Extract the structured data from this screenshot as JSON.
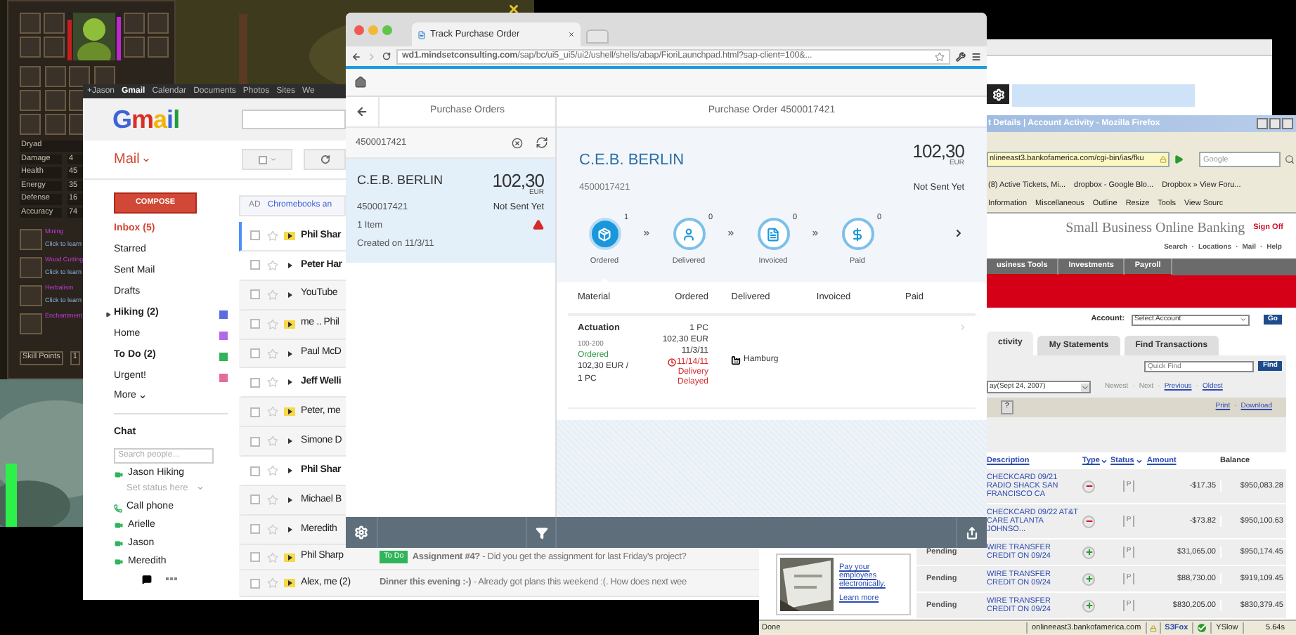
{
  "game": {
    "bars": [
      {
        "level": 0.85,
        "color": "#c81e1e"
      },
      {
        "level": 0.9,
        "color": "#c026d3"
      }
    ],
    "class_name": "Dryad",
    "stats": [
      {
        "label": "Damage",
        "value": "4"
      },
      {
        "label": "Health",
        "value": "45"
      },
      {
        "label": "Energy",
        "value": "35"
      },
      {
        "label": "Defense",
        "value": "16"
      },
      {
        "label": "Accuracy",
        "value": "74"
      }
    ],
    "skills": [
      {
        "name": "Mining",
        "action": "Click to learn"
      },
      {
        "name": "Wood Cutting",
        "action": "Click to learn"
      },
      {
        "name": "Herbalism",
        "action": "Click to learn"
      },
      {
        "name": "Enchantment"
      }
    ],
    "skill_points": {
      "label": "Skill Points",
      "value": "1"
    }
  },
  "gmail": {
    "top_links": [
      {
        "label": "+Jason",
        "selected": false
      },
      {
        "label": "Gmail",
        "selected": true
      },
      {
        "label": "Calendar",
        "selected": false
      },
      {
        "label": "Documents",
        "selected": false
      },
      {
        "label": "Photos",
        "selected": false
      },
      {
        "label": "Sites",
        "selected": false
      },
      {
        "label": "We",
        "selected": false
      }
    ],
    "logo": "Gmail",
    "app_menu": "Mail",
    "compose": "COMPOSE",
    "labels": [
      {
        "name": "Inbox (5)",
        "selected": true,
        "unread": true,
        "collapsible": false
      },
      {
        "name": "Starred",
        "selected": false,
        "unread": false,
        "collapsible": false
      },
      {
        "name": "Sent Mail",
        "selected": false,
        "unread": false,
        "collapsible": false
      },
      {
        "name": "Drafts",
        "selected": false,
        "unread": false,
        "collapsible": false
      },
      {
        "name": "Hiking (2)",
        "selected": false,
        "unread": true,
        "collapsible": true,
        "color": "#5b6be0"
      },
      {
        "name": "Home",
        "selected": false,
        "unread": false,
        "collapsible": false,
        "color": "#b468e3"
      },
      {
        "name": "To Do (2)",
        "selected": false,
        "unread": true,
        "collapsible": false,
        "color": "#2fb45a"
      },
      {
        "name": "Urgent!",
        "selected": false,
        "unread": false,
        "collapsible": false,
        "color": "#e56a9e"
      }
    ],
    "more": "More",
    "chat": {
      "title": "Chat",
      "search": {
        "placeholder": "Search people..."
      },
      "me": {
        "name": "Jason Hiking",
        "status": {
          "placeholder": "Set status here"
        }
      },
      "call": "Call phone",
      "contacts": [
        "Arielle",
        "Jason",
        "Meredith"
      ]
    },
    "ad": {
      "tag": "AD",
      "text": "Chromebooks an"
    },
    "messages": [
      {
        "sender": "Phil Shar",
        "unread": true,
        "important": true,
        "selected": true
      },
      {
        "sender": "Peter Har",
        "unread": true,
        "important": false,
        "selected": false
      },
      {
        "sender": "YouTube",
        "unread": false,
        "important": false,
        "selected": false
      },
      {
        "sender": "me .. Phil",
        "unread": false,
        "important": true,
        "selected": false
      },
      {
        "sender": "Paul McD",
        "unread": false,
        "important": false,
        "selected": false
      },
      {
        "sender": "Jeff Welli",
        "unread": true,
        "important": false,
        "selected": false
      },
      {
        "sender": "Peter, me",
        "unread": false,
        "important": true,
        "selected": false
      },
      {
        "sender": "Simone D",
        "unread": false,
        "important": false,
        "selected": false
      },
      {
        "sender": "Phil Shar",
        "unread": true,
        "important": false,
        "selected": false
      },
      {
        "sender": "Michael B",
        "unread": false,
        "important": false,
        "selected": false
      },
      {
        "sender": "Meredith",
        "unread": false,
        "important": false,
        "selected": false
      },
      {
        "sender": "Phil Sharp",
        "unread": false,
        "important": true,
        "selected": false,
        "tag": {
          "label": "To Do",
          "color": "#2fb45a"
        },
        "text": "**Assignment #4?** - Did you get the assignment for last Friday's project?"
      },
      {
        "sender": "Alex, me (2)",
        "unread": false,
        "important": true,
        "selected": false,
        "text": "**Dinner this evening :-)** - Already got plans this weekend :(. How does next wee"
      }
    ]
  },
  "fiori": {
    "tab": "Track Purchase Order",
    "url": "**wd1.mindsetconsulting.com**/sap/bc/ui5_ui5/ui2/ushell/shells/abap/FioriLaunchpad.html?sap-client=100&...",
    "master": {
      "title": "Purchase Orders",
      "search": {
        "value": "4500017421"
      },
      "items": [
        {
          "name": "C.E.B. BERLIN",
          "amount": "102,30",
          "currency": "EUR",
          "number": "4500017421",
          "status": "Not Sent Yet",
          "count": "1 Item",
          "created": "Created on 11/3/11",
          "warning": true,
          "selected": true
        }
      ]
    },
    "detail": {
      "title": "Purchase Order 4500017421",
      "header": {
        "name": "C.E.B. BERLIN",
        "amount": "102,30",
        "currency": "EUR",
        "number": "4500017421",
        "status": "Not Sent Yet"
      },
      "flow": [
        {
          "label": "Ordered",
          "count": "1",
          "selected": true,
          "kind": "ordered"
        },
        {
          "label": "Delivered",
          "count": "0",
          "selected": false,
          "kind": "delivered"
        },
        {
          "label": "Invoiced",
          "count": "0",
          "selected": false,
          "kind": "invoiced"
        },
        {
          "label": "Paid",
          "count": "0",
          "selected": false,
          "kind": "paid"
        }
      ],
      "table": {
        "columns": [
          "Material",
          "Ordered",
          "Delivered",
          "Invoiced",
          "Paid"
        ],
        "rows": [
          {
            "material": {
              "name": "Actuation",
              "id": "100-200",
              "status": "Ordered",
              "price": "102,30 EUR / 1 PC"
            },
            "ordered": {
              "quantity": "1 PC",
              "value": "102,30 EUR",
              "date": "11/3/11",
              "due": "11/14/11",
              "alert": "Delivery Delayed"
            },
            "delivered": {
              "plant": "Hamburg"
            }
          }
        ]
      }
    }
  },
  "bank": {
    "title": "t Details | Account Activity - Mozilla Firefox",
    "url": "nlineeast3.bankofamerica.com/cgi-bin/ias/fku",
    "search": {
      "placeholder": "Google"
    },
    "bookmarks": [
      "(8) Active Tickets, Mi...",
      "dropbox - Google Blo...",
      "Dropbox » View Foru..."
    ],
    "tools": [
      "Information",
      "Miscellaneous",
      "Outline",
      "Resize",
      "Tools",
      "View Sourc"
    ],
    "site_title": "Small Business Online Banking",
    "sign_off": "Sign Off",
    "separator": "·",
    "links": [
      "Search",
      "Locations",
      "Mail",
      "Help"
    ],
    "nav": [
      "usiness Tools",
      "Investments",
      "Payroll"
    ],
    "account": {
      "label": "Account:",
      "select": "Select Account",
      "go": "Go"
    },
    "tabs": [
      {
        "label": "ctivity",
        "selected": true
      },
      {
        "label": "My Statements",
        "selected": false
      },
      {
        "label": "Find Transactions",
        "selected": false
      }
    ],
    "quick_find": {
      "placeholder": "Quick Find",
      "button": "Find"
    },
    "period": "ay(Sept 24, 2007)",
    "pager": [
      {
        "label": "Newest",
        "link": false
      },
      {
        "label": "Next",
        "link": false
      },
      {
        "label": "Previous",
        "link": true
      },
      {
        "label": "Oldest",
        "link": true
      }
    ],
    "help": "?",
    "actions": [
      "Print",
      "Download"
    ],
    "columns": [
      {
        "label": "Description",
        "link": true,
        "sortable": false
      },
      {
        "label": "Type",
        "link": true,
        "sortable": true
      },
      {
        "label": "Status",
        "link": true,
        "sortable": true
      },
      {
        "label": "Amount",
        "link": true,
        "sortable": false
      },
      {
        "label": "Balance",
        "link": false,
        "sortable": false
      }
    ],
    "transactions": [
      {
        "description": "CHECKCARD 09/21 RADIO SHACK SAN FRANCISCO CA",
        "kind": "debit",
        "flag": "P",
        "amount": "-$17.35",
        "balance": "$950,083.28"
      },
      {
        "description": "CHECKCARD 09/22 AT&T CARE ATLANTA JOHNSO...",
        "kind": "debit",
        "flag": "P",
        "amount": "-$73.82",
        "balance": "$950,100.63"
      },
      {
        "status": "Pending",
        "description": "WIRE TRANSFER CREDIT ON 09/24",
        "kind": "credit",
        "flag": "P",
        "amount": "$31,065.00",
        "balance": "$950,174.45"
      },
      {
        "status": "Pending",
        "description": "WIRE TRANSFER CREDIT ON 09/24",
        "kind": "credit",
        "flag": "P",
        "amount": "$88,730.00",
        "balance": "$919,109.45"
      },
      {
        "status": "Pending",
        "description": "WIRE TRANSFER CREDIT ON 09/24",
        "kind": "credit",
        "flag": "P",
        "amount": "$830,205.00",
        "balance": "$830,379.45"
      }
    ],
    "ad": {
      "text": "Pay your employees electronically.",
      "link": "Learn more"
    },
    "status_bar": {
      "text": "Done",
      "host": "onlineeast3.bankofamerica.com",
      "addons": [
        "S3Fox",
        "YSlow"
      ],
      "time": "5.64s"
    }
  }
}
